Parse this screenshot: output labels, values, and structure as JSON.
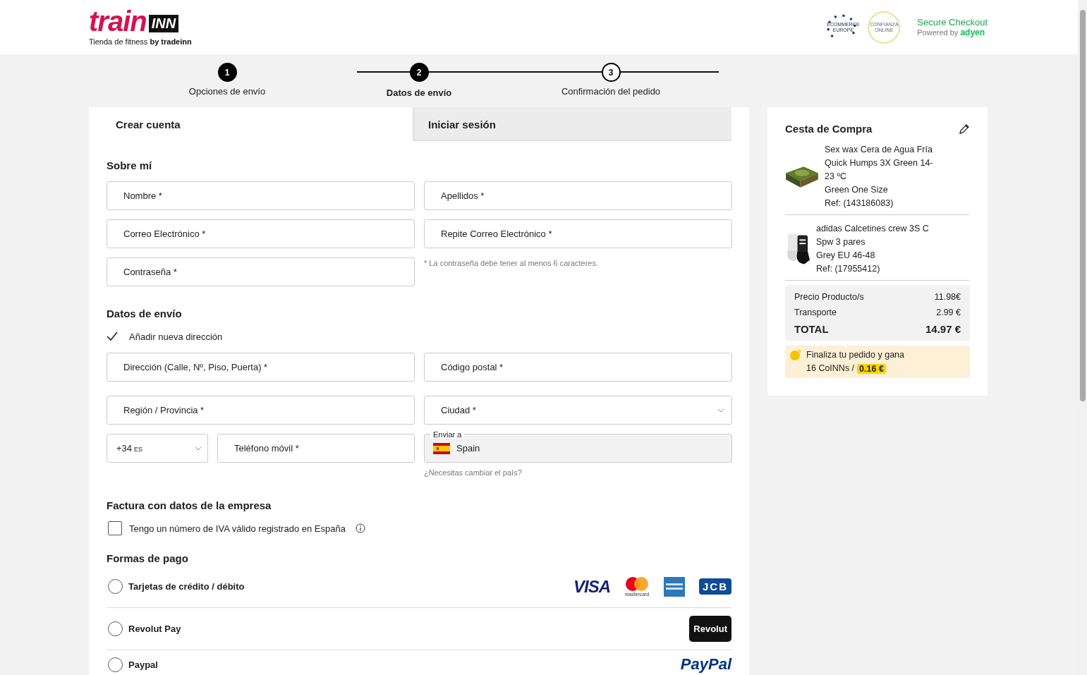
{
  "header": {
    "logo": {
      "brand": "train",
      "brand_box": "INN",
      "tagline": "Tienda de fitness **by tradeinn**"
    },
    "trust_badges": [
      {
        "kind": "stars",
        "text": "ECOMMERCE EUROPE"
      },
      {
        "kind": "ring",
        "text": "CONFIANZA ONLINE"
      }
    ],
    "secure": {
      "title": "Secure Checkout",
      "powered": "Powered by",
      "provider": "adyen"
    }
  },
  "steps": [
    {
      "number": "1",
      "label": "Opciones de envío",
      "filled": true,
      "selected": false
    },
    {
      "number": "2",
      "label": "Datos de envío",
      "filled": true,
      "selected": true
    },
    {
      "number": "3",
      "label": "Confirmación del pedido",
      "filled": false,
      "selected": false
    }
  ],
  "tabs": [
    {
      "label": "Crear cuenta",
      "selected": true
    },
    {
      "label": "Iniciar sesión",
      "selected": false
    }
  ],
  "about": {
    "title": "Sobre mí",
    "fields": [
      {
        "placeholder": "Nombre *"
      },
      {
        "placeholder": "Apellidos *"
      },
      {
        "placeholder": "Correo Electrónico *"
      },
      {
        "placeholder": "Repite Correo Electrónico *"
      },
      {
        "placeholder": "Contraseña *"
      }
    ],
    "password_hint": "* La contraseña debe tener al menos 6 caracteres."
  },
  "shipping": {
    "title": "Datos de envío",
    "add_address": {
      "label": "Añadir nueva dirección",
      "checked": true
    },
    "fields": [
      {
        "placeholder": "Dirección (Calle, Nº, Piso, Puerta) *",
        "kind": "text"
      },
      {
        "placeholder": "Código postal *",
        "kind": "text"
      },
      {
        "placeholder": "Región / Provincia *",
        "kind": "text"
      },
      {
        "placeholder": "Ciudad *",
        "kind": "select"
      }
    ],
    "phone_prefix": {
      "value": "+34",
      "suffix": "ES"
    },
    "phone": {
      "placeholder": "Teléfono móvil *"
    },
    "country": {
      "label": "Enviar a",
      "value": "Spain"
    },
    "change_country": "¿Necesitas cambiar el país?"
  },
  "invoice": {
    "title": "Factura con datos de la empresa",
    "vat": {
      "label": "Tengo un número de IVA válido registrado en España",
      "checked": false
    }
  },
  "payment": {
    "title": "Formas de pago",
    "methods": [
      {
        "label": "Tarjetas de crédito / débito",
        "kind": "cards",
        "selected": false,
        "logos": [
          "VISA",
          "mastercard",
          "JCB"
        ]
      },
      {
        "label": "Revolut Pay",
        "kind": "revolut",
        "selected": false,
        "logos": [
          "Revolut"
        ]
      },
      {
        "label": "Paypal",
        "kind": "paypal",
        "selected": false,
        "logos": [
          "PayPal"
        ]
      }
    ]
  },
  "cart": {
    "title": "Cesta de Compra",
    "items": [
      {
        "kind": "wax",
        "name": "Sex wax Cera de Agua Fría Quick Humps 3X Green 14-23 ºC",
        "variant": "Green One Size",
        "ref": "Ref: (143186083)"
      },
      {
        "kind": "socks",
        "name": "adidas Calcetines crew 3S C Spw 3 pares",
        "variant": "Grey EU 46-48",
        "ref": "Ref: (17955412)"
      }
    ],
    "totals": [
      {
        "label": "Precio Producto/s",
        "value": "11.98€",
        "kind": "line"
      },
      {
        "label": "Transporte",
        "value": "2.99 €",
        "kind": "line"
      },
      {
        "label": "TOTAL",
        "value": "14.97 €",
        "kind": "total"
      }
    ],
    "reward": {
      "text": "Finaliza tu pedido y gana",
      "coins": "16 CoINNs /",
      "amount": "0.16 €"
    }
  }
}
